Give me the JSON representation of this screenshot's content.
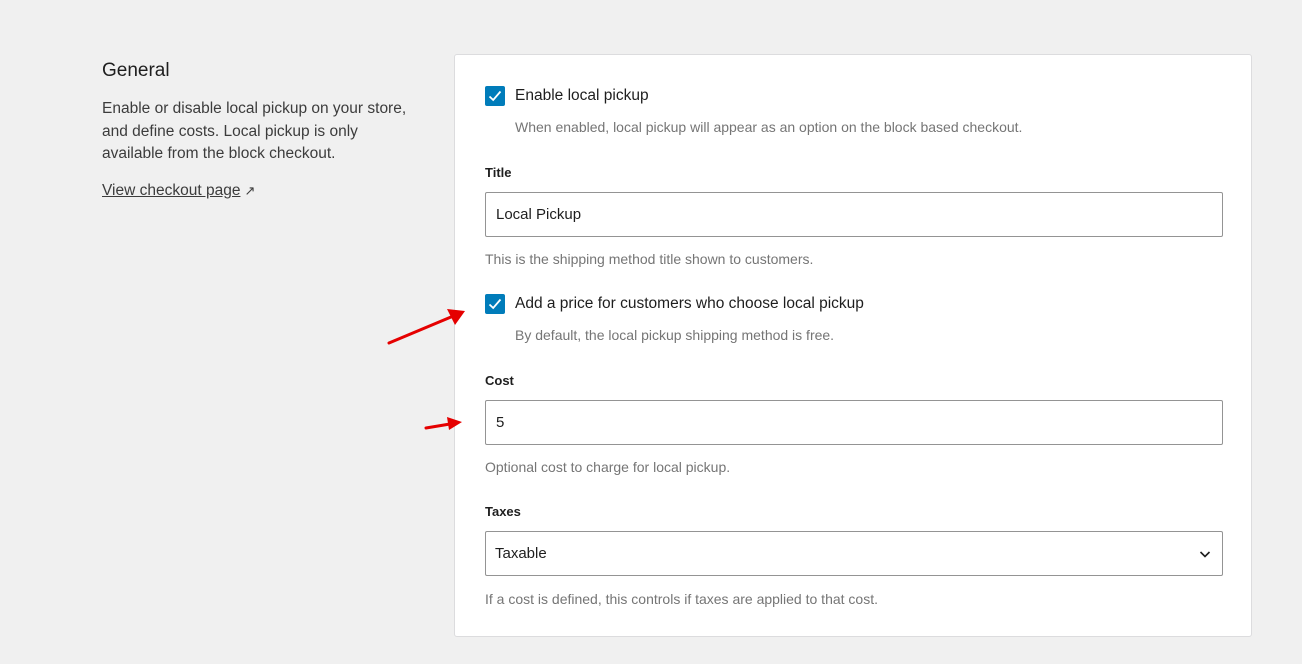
{
  "sidebar": {
    "heading": "General",
    "description": "Enable or disable local pickup on your store, and define costs. Local pickup is only available from the block checkout.",
    "link_label": "View checkout page",
    "link_icon": "external-link-icon",
    "link_glyph": "↗"
  },
  "form": {
    "enable": {
      "label": "Enable local pickup",
      "help": "When enabled, local pickup will appear as an option on the block based checkout.",
      "checked": true
    },
    "title": {
      "label": "Title",
      "value": "Local Pickup",
      "help": "This is the shipping method title shown to customers."
    },
    "add_price": {
      "label": "Add a price for customers who choose local pickup",
      "help": "By default, the local pickup shipping method is free.",
      "checked": true
    },
    "cost": {
      "label": "Cost",
      "value": "5",
      "help": "Optional cost to charge for local pickup."
    },
    "taxes": {
      "label": "Taxes",
      "selected": "Taxable",
      "help": "If a cost is defined, this controls if taxes are applied to that cost."
    }
  },
  "colors": {
    "accent": "#007cba",
    "annotation": "#e50000"
  }
}
